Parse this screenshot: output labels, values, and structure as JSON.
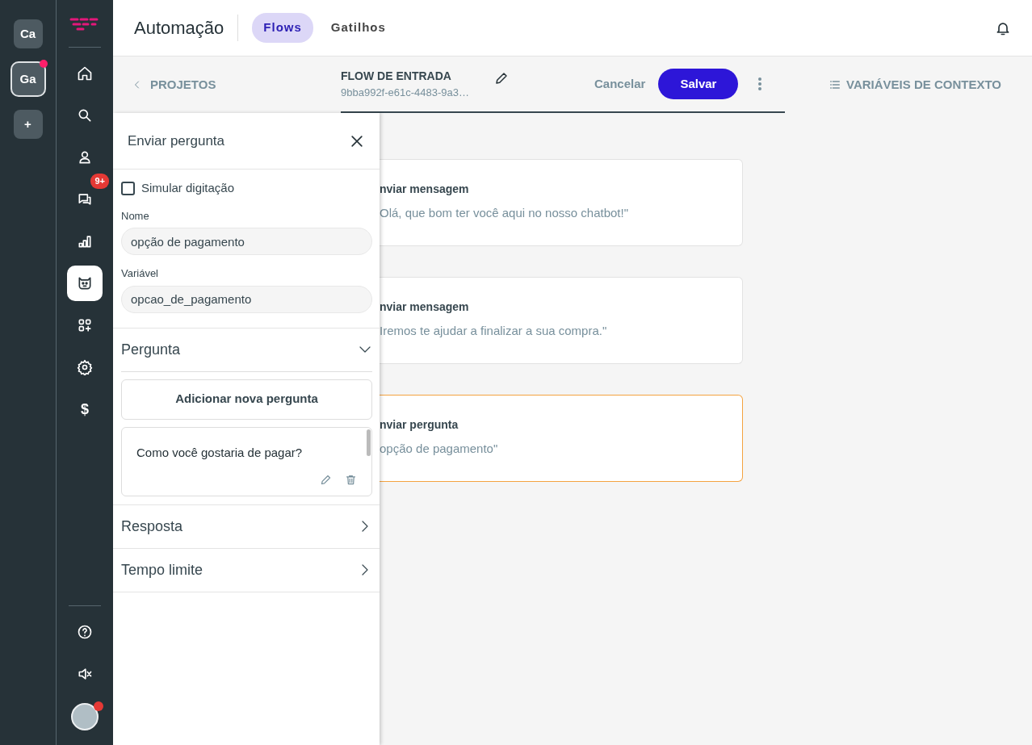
{
  "workspaces": [
    {
      "label": "Ca",
      "selected": false,
      "notification": false
    },
    {
      "label": "Ga",
      "selected": true,
      "notification": true
    },
    {
      "label": "+",
      "selected": false,
      "notification": false
    }
  ],
  "nav": [
    {
      "active": false
    },
    {
      "active": false
    },
    {
      "active": false
    },
    {
      "active": false,
      "badge": "9+"
    },
    {
      "active": false
    },
    {
      "active": true
    },
    {
      "active": false
    },
    {
      "active": false
    },
    {
      "active": false,
      "glyph": "$"
    }
  ],
  "avatar": {
    "notification": true
  },
  "header": {
    "title": "Automação",
    "tabs": [
      {
        "label": "Flows",
        "selected": true
      },
      {
        "label": "Gatilhos",
        "selected": false
      }
    ]
  },
  "subheader": {
    "back": "PROJETOS",
    "flow_name": "FLOW DE ENTRADA",
    "flow_id": "9bba992f-e61c-4483-9a3…",
    "cancel": "Cancelar",
    "save": "Salvar",
    "context": "VARIÁVEIS DE CONTEXTO"
  },
  "panel": {
    "title": "Enviar pergunta",
    "simulate": {
      "label": "Simular digitação",
      "checked": false
    },
    "fields": [
      {
        "label": "Nome",
        "value": "opção de pagamento"
      },
      {
        "label": "Variável",
        "value": "opcao_de_pagamento"
      }
    ],
    "sections": [
      {
        "title": "Pergunta",
        "expanded": true,
        "add_button": "Adicionar nova pergunta",
        "questions": [
          "Como você gostaria de pagar?"
        ]
      },
      {
        "title": "Resposta",
        "expanded": false
      },
      {
        "title": "Tempo limite",
        "expanded": false
      }
    ]
  },
  "canvas": {
    "nodes": [
      {
        "title": "nviar mensagem",
        "text": "Olá, que bom ter você aqui no nosso chatbot!\"",
        "selected": false
      },
      {
        "title": "nviar mensagem",
        "text": "Iremos te ajudar a finalizar a sua compra.\"",
        "selected": false
      },
      {
        "title": "nviar pergunta",
        "text": "opção de pagamento\"",
        "selected": true
      }
    ]
  }
}
